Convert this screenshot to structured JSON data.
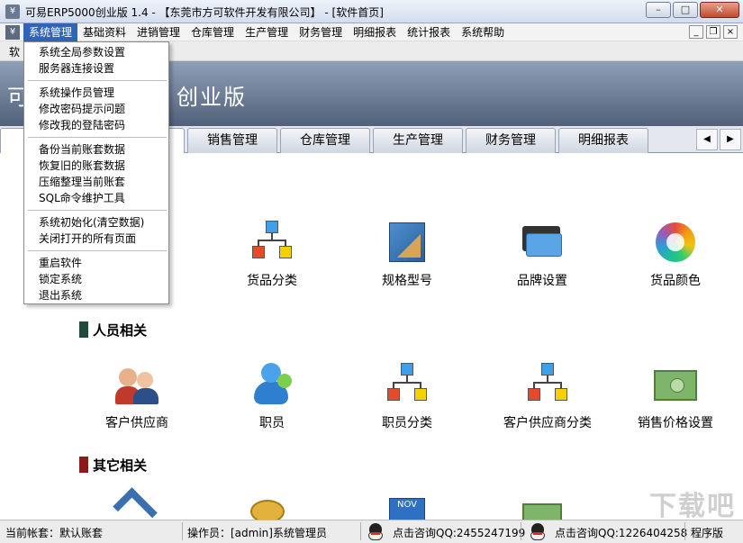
{
  "window": {
    "title": "可易ERP5000创业版 1.4 - 【东莞市方可软件开发有限公司】 - [软件首页]",
    "app_icon_glyph": "¥",
    "minimize_glyph": "–",
    "maximize_glyph": "□",
    "close_glyph": "✕"
  },
  "menubar": {
    "items": [
      "系统管理",
      "基础资料",
      "进销管理",
      "仓库管理",
      "生产管理",
      "财务管理",
      "明细报表",
      "统计报表",
      "系统帮助"
    ],
    "mdi_minimize": "_",
    "mdi_restore": "❐",
    "mdi_close": "×"
  },
  "toolrow": {
    "label": "软"
  },
  "banner": {
    "title_prefix": "可",
    "title_suffix": "创业版"
  },
  "tabs": {
    "items": [
      "销售管理",
      "仓库管理",
      "生产管理",
      "财务管理",
      "明细报表"
    ],
    "scroll_left": "◀",
    "scroll_right": "▶"
  },
  "dropdown": {
    "group1": [
      "系统全局参数设置",
      "服务器连接设置"
    ],
    "group2": [
      "系统操作员管理",
      "修改密码提示问题",
      "修改我的登陆密码"
    ],
    "group3": [
      "备份当前账套数据",
      "恢复旧的账套数据",
      "压缩整理当前账套",
      "SQL命令维护工具"
    ],
    "group4": [
      "系统初始化(清空数据)",
      "关闭打开的所有页面"
    ],
    "group5": [
      "重启软件",
      "锁定系统",
      "退出系统"
    ]
  },
  "sections": {
    "people": {
      "title": "人员相关",
      "color": "#1f4a3c"
    },
    "other": {
      "title": "其它相关",
      "color": "#8b1a1a"
    }
  },
  "tiles_row1": [
    "货品分类",
    "规格型号",
    "品牌设置",
    "货品颜色"
  ],
  "tiles_row2": [
    "客户供应商",
    "职员",
    "职员分类",
    "客户供应商分类",
    "销售价格设置"
  ],
  "partial_calendar_text": "NOV",
  "watermark": "下载吧",
  "statusbar": {
    "account": "当前帐套：默认账套",
    "operator": "操作员：[admin]系统管理员",
    "qq1": "点击咨询QQ:2455247199",
    "qq2": "点击咨询QQ:1226404258",
    "edition": "程序版"
  }
}
